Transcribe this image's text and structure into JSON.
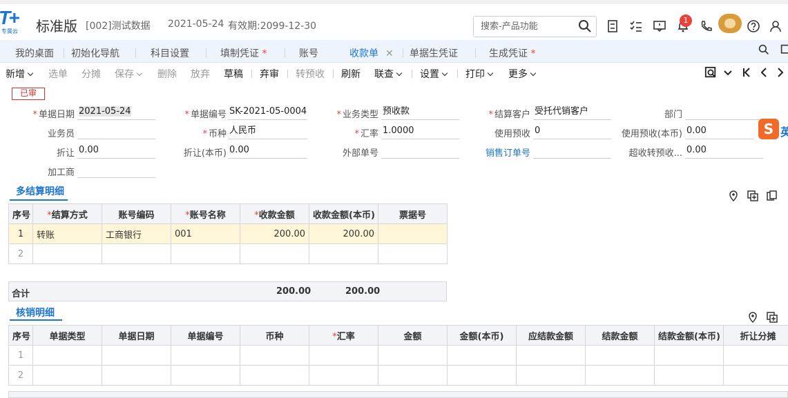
{
  "header": {
    "logo_text": "T+",
    "logo_sub": "专属云",
    "edition": "标准版",
    "company": "[002]测试数据",
    "date": "2021-05-24",
    "valid": "有效期:2099-12-30",
    "search_placeholder": "搜索-产品功能",
    "notification_count": "1"
  },
  "tabs": [
    {
      "label": "我的桌面",
      "star": ""
    },
    {
      "label": "初始化导航",
      "star": ""
    },
    {
      "label": "科目设置",
      "star": ""
    },
    {
      "label": "填制凭证",
      "star": " *"
    },
    {
      "label": "账号",
      "star": ""
    },
    {
      "label": "收款单",
      "star": "",
      "close": "✕"
    },
    {
      "label": "单据生凭证",
      "star": ""
    },
    {
      "label": "生成凭证",
      "star": " *"
    }
  ],
  "toolbar": {
    "new": "新增",
    "select": "选单",
    "split": "分摊",
    "save": "保存",
    "delete": "删除",
    "abandon": "放弃",
    "draft": "草稿",
    "unaudit": "弃审",
    "to_prepaid": "转预收",
    "refresh": "刷新",
    "link": "联查",
    "settings": "设置",
    "print": "打印",
    "more": "更多"
  },
  "stamp": "已审",
  "form": {
    "doc_date_label": "单据日期",
    "doc_date": "2021-05-24",
    "doc_no_label": "单据编号",
    "doc_no": "SK-2021-05-0004",
    "biz_type_label": "业务类型",
    "biz_type": "预收款",
    "customer_label": "结算客户",
    "customer": "受托代销客户",
    "dept_label": "部门",
    "dept": "",
    "salesman_label": "业务员",
    "salesman": "",
    "currency_label": "币种",
    "currency": "人民币",
    "rate_label": "汇率",
    "rate": "1.0000",
    "use_prepaid_label": "使用预收",
    "use_prepaid": "0",
    "use_prepaid_local_label": "使用预收(本币)",
    "use_prepaid_local": "0.00",
    "discount_label": "折让",
    "discount": "0.00",
    "discount_local_label": "折让(本币)",
    "discount_local": "0.00",
    "ext_no_label": "外部单号",
    "ext_no": "",
    "so_no_label": "销售订单号",
    "so_no": "",
    "over_prepaid_label": "超收转预收...",
    "over_prepaid": "0.00",
    "processor_label": "加工商",
    "processor": ""
  },
  "section1": {
    "title": "多结算明细",
    "headers": [
      "序号",
      "结算方式",
      "账号编码",
      "账号名称",
      "收款金额",
      "收款金额(本币)",
      "票据号"
    ],
    "rows": [
      {
        "idx": "1",
        "method": "转账",
        "acct_code": "工商银行",
        "acct_name": "001",
        "amount": "200.00",
        "amount_local": "200.00",
        "bill_no": ""
      },
      {
        "idx": "2",
        "method": "",
        "acct_code": "",
        "acct_name": "",
        "amount": "",
        "amount_local": "",
        "bill_no": ""
      }
    ],
    "total_label": "合计",
    "total_amount": "200.00",
    "total_amount_local": "200.00"
  },
  "section2": {
    "title": "核销明细",
    "headers": [
      "序号",
      "单据类型",
      "单据日期",
      "单据编号",
      "币种",
      "汇率",
      "金额",
      "金额(本币)",
      "应结款金额",
      "结款金额",
      "结款金额(本币)",
      "折让分摊"
    ],
    "rows": [
      {
        "idx": "1"
      },
      {
        "idx": "2"
      }
    ]
  },
  "ime": {
    "logo": "S",
    "mode": "英"
  }
}
